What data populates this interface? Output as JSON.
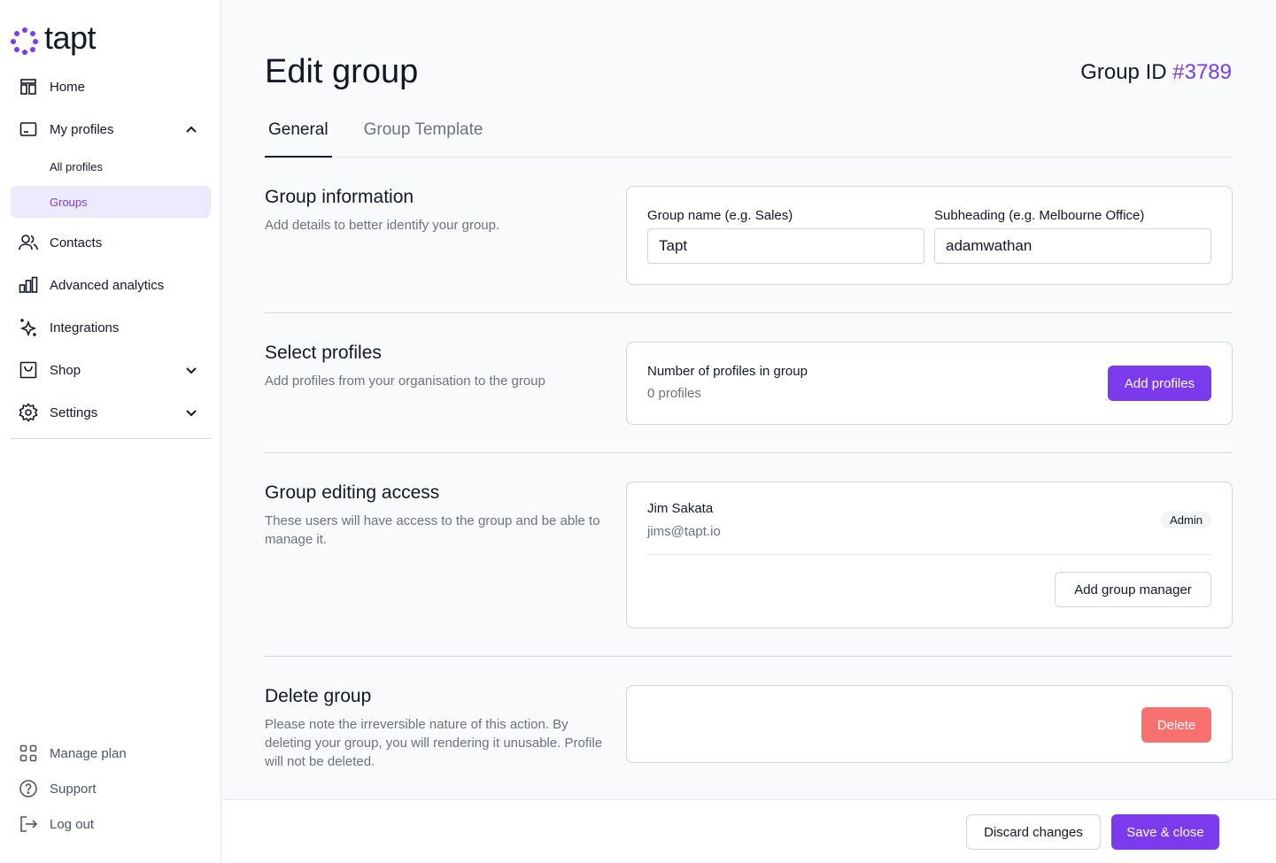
{
  "brand": {
    "name": "tapt",
    "accent": "#7c3aed"
  },
  "sidebar": {
    "items": [
      {
        "label": "Home",
        "icon": "home-icon"
      },
      {
        "label": "My profiles",
        "icon": "profile-card-icon",
        "expanded": true,
        "children": [
          {
            "label": "All profiles"
          },
          {
            "label": "Groups",
            "active": true
          }
        ]
      },
      {
        "label": "Contacts",
        "icon": "contacts-icon"
      },
      {
        "label": "Advanced analytics",
        "icon": "analytics-icon"
      },
      {
        "label": "Integrations",
        "icon": "sparkle-icon"
      },
      {
        "label": "Shop",
        "icon": "shopping-bag-icon"
      },
      {
        "label": "Settings",
        "icon": "gear-icon"
      }
    ],
    "bottom": [
      {
        "label": "Manage plan",
        "icon": "grid-icon"
      },
      {
        "label": "Support",
        "icon": "help-icon"
      },
      {
        "label": "Log out",
        "icon": "logout-icon"
      }
    ]
  },
  "header": {
    "title": "Edit group",
    "group_id_label": "Group ID",
    "group_id": "#3789"
  },
  "tabs": [
    {
      "label": "General",
      "active": true
    },
    {
      "label": "Group Template"
    }
  ],
  "group_info": {
    "title": "Group information",
    "description": "Add details to better identify your group.",
    "name_label": "Group name (e.g. Sales)",
    "name_value": "Tapt",
    "subheading_label": "Subheading (e.g. Melbourne Office)",
    "subheading_value": "adamwathan"
  },
  "select_profiles": {
    "title": "Select profiles",
    "description": "Add profiles from your organisation to the group",
    "count_label": "Number of profiles in group",
    "count_value": "0 profiles",
    "add_button": "Add profiles"
  },
  "editing_access": {
    "title": "Group editing access",
    "description": "These users will have access to the group and be able to manage it.",
    "manager_name": "Jim Sakata",
    "manager_email": "jims@tapt.io",
    "manager_role": "Admin",
    "add_manager_button": "Add group manager"
  },
  "delete_group": {
    "title": "Delete group",
    "description": "Please note the irreversible nature of this action. By deleting your group, you will rendering it unusable. Profile will not be deleted.",
    "delete_button": "Delete"
  },
  "footer": {
    "discard_button": "Discard changes",
    "save_button": "Save & close"
  }
}
